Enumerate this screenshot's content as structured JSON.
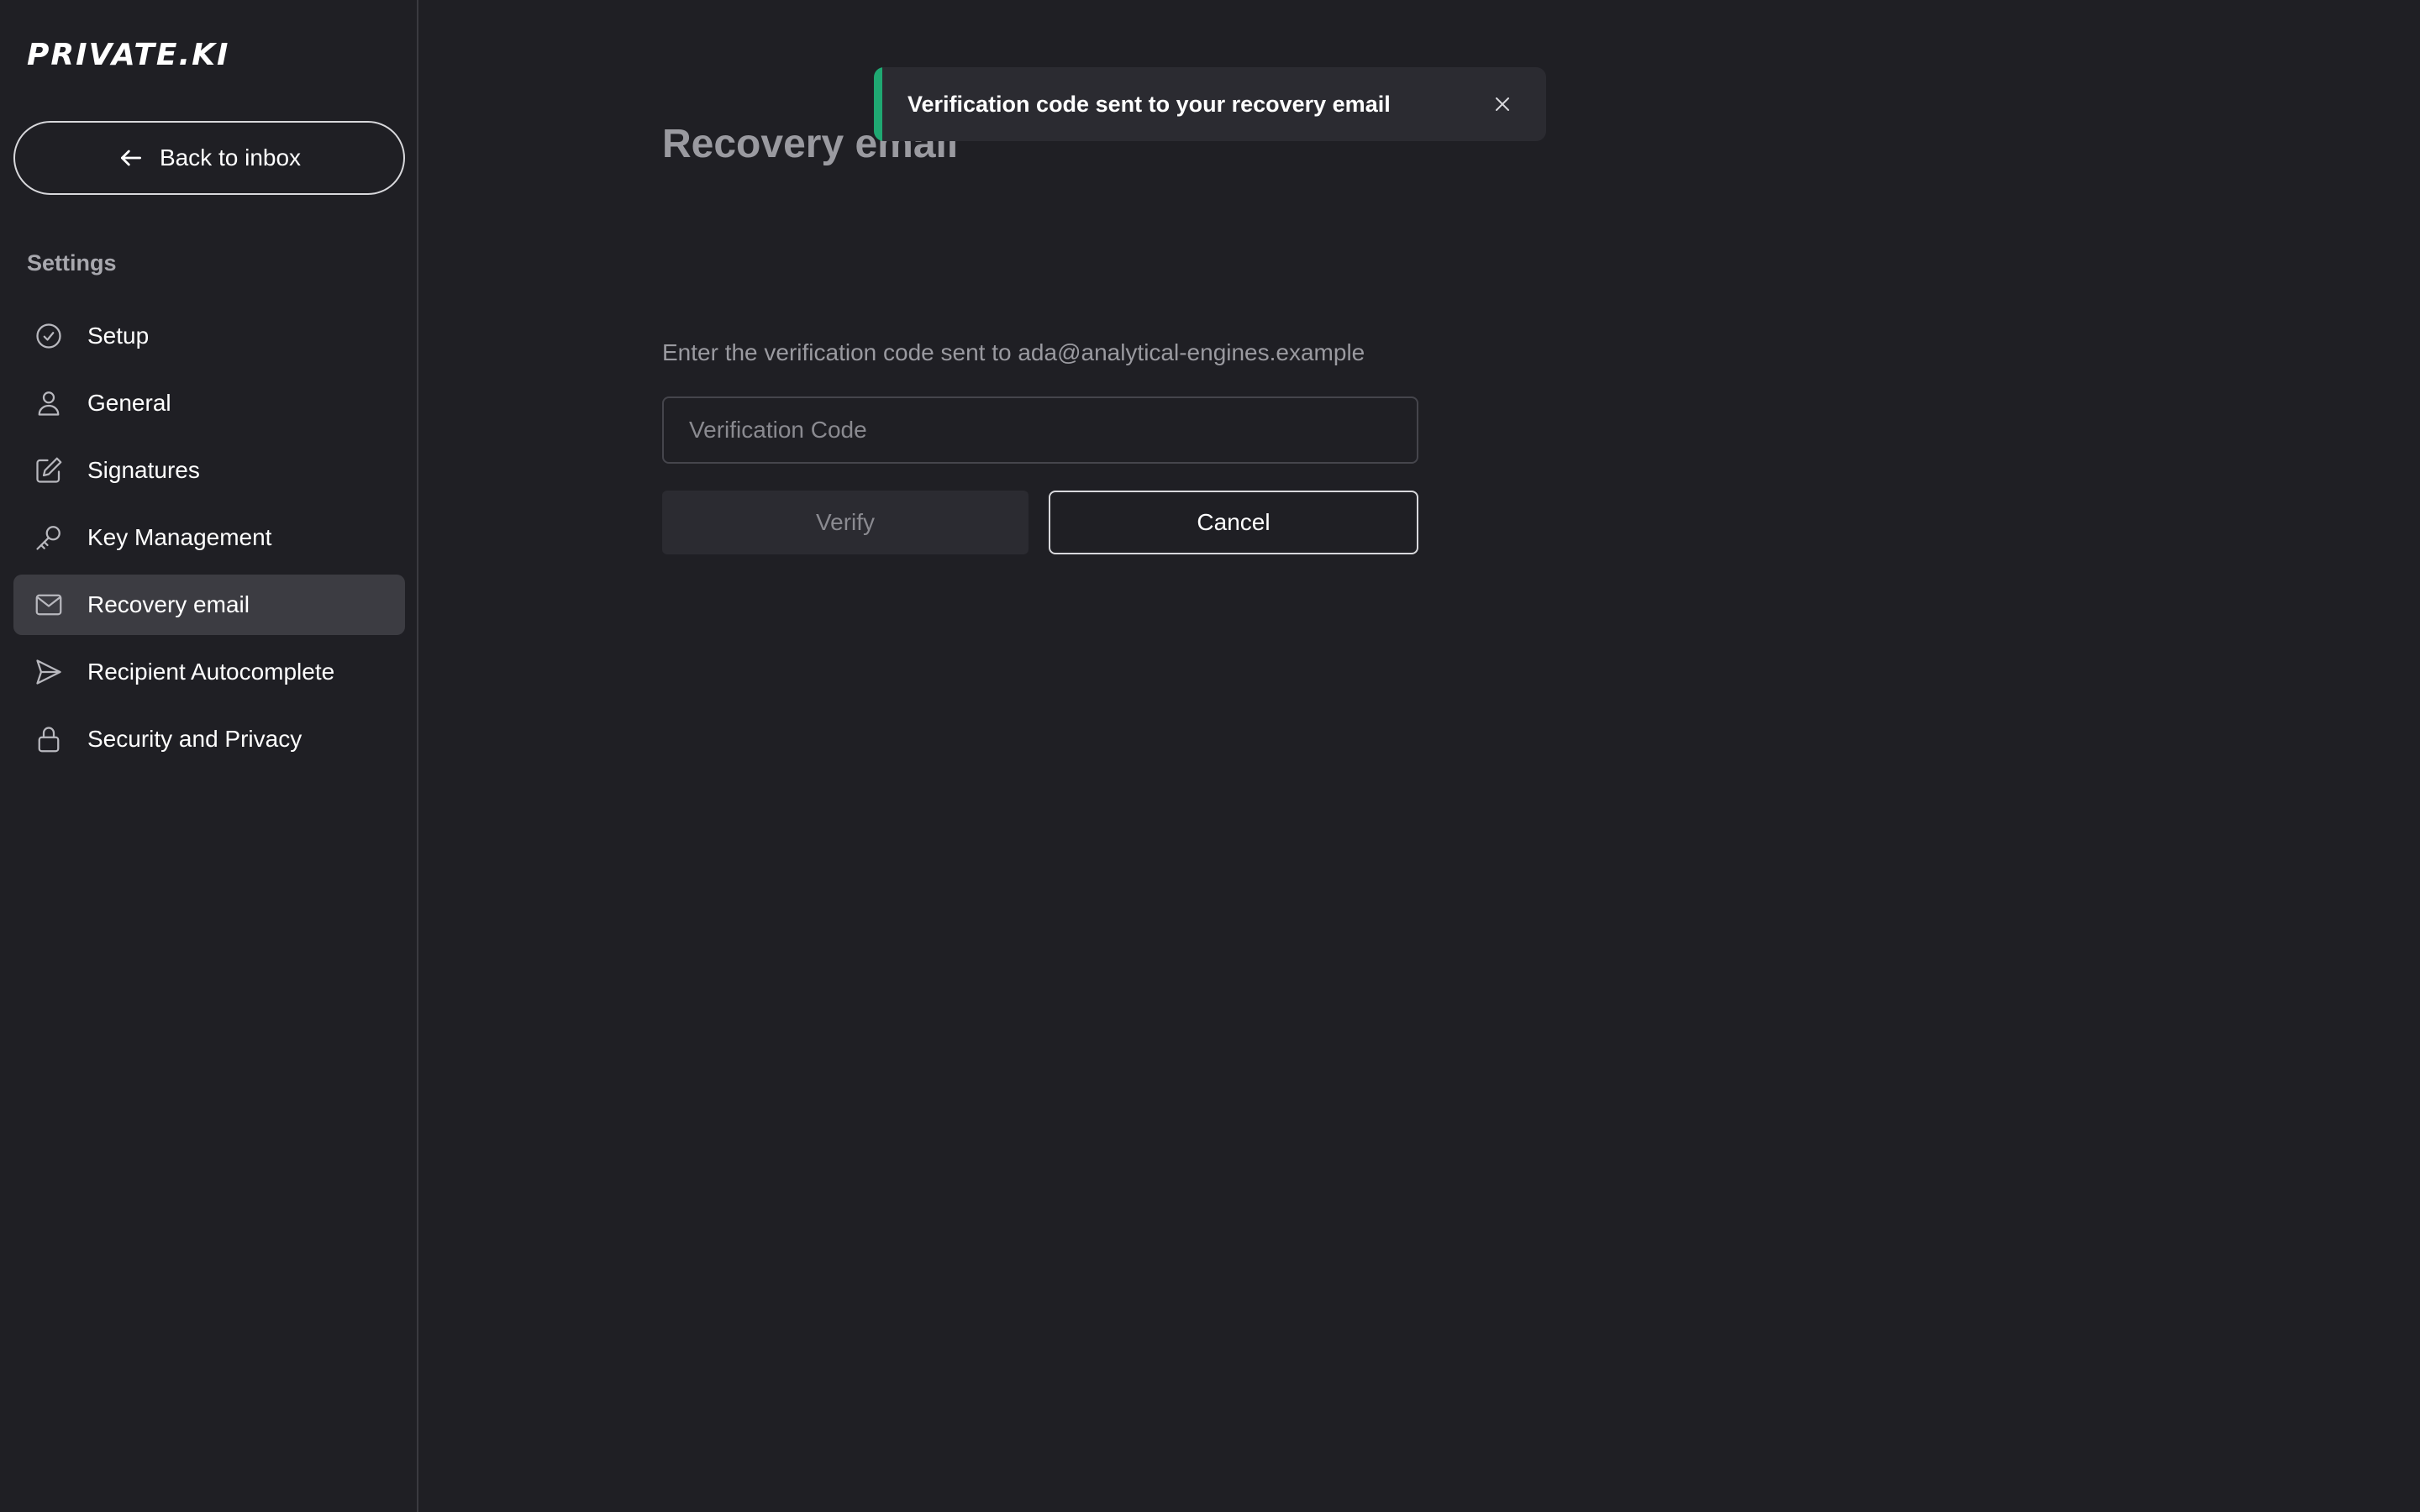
{
  "brand": {
    "logo_text": "PRIVATE.KI"
  },
  "sidebar": {
    "back_label": "Back to inbox",
    "section_label": "Settings",
    "items": [
      {
        "label": "Setup",
        "icon": "check-circle-icon",
        "active": false
      },
      {
        "label": "General",
        "icon": "user-icon",
        "active": false
      },
      {
        "label": "Signatures",
        "icon": "pencil-square-icon",
        "active": false
      },
      {
        "label": "Key Management",
        "icon": "key-icon",
        "active": false
      },
      {
        "label": "Recovery email",
        "icon": "envelope-icon",
        "active": true
      },
      {
        "label": "Recipient Autocomplete",
        "icon": "send-icon",
        "active": false
      },
      {
        "label": "Security and Privacy",
        "icon": "lock-icon",
        "active": false
      }
    ]
  },
  "main": {
    "title": "Recovery email",
    "instruction": "Enter the verification code sent to ada@analytical-engines.example",
    "code_input": {
      "placeholder": "Verification Code",
      "value": ""
    },
    "verify_label": "Verify",
    "cancel_label": "Cancel"
  },
  "toast": {
    "message": "Verification code sent to your recovery email",
    "accent_color": "#1fa872"
  },
  "colors": {
    "background": "#1f1f24",
    "active_nav": "#3c3c42",
    "muted_text": "#9a9aa0"
  }
}
